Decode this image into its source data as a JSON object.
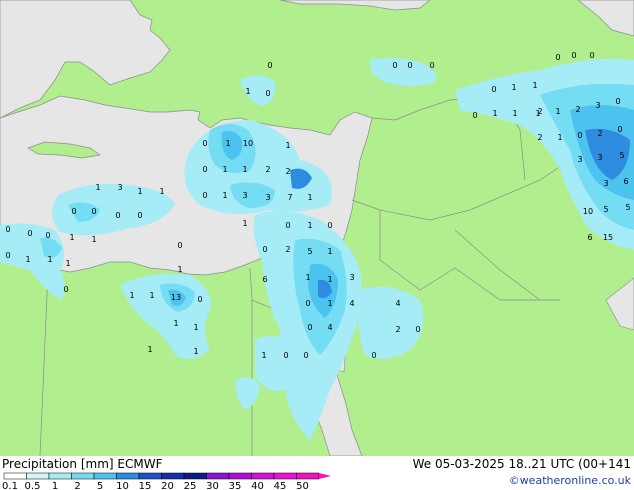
{
  "map": {
    "land_color": "#b0ee8e",
    "sea_color": "#e6e6e6",
    "border_color": "#8c8c8c",
    "labels": [
      "0",
      "1",
      "0",
      "0",
      "0",
      "0",
      "0",
      "0",
      "0",
      "1",
      "0",
      "1",
      "2",
      "2",
      "3",
      "0",
      "0",
      "1",
      "1",
      "1",
      "1",
      "2",
      "1",
      "0",
      "2",
      "0",
      "3",
      "3",
      "5",
      "3",
      "6",
      "10",
      "5",
      "5",
      "15",
      "6",
      "0",
      "1",
      "10",
      "1",
      "0",
      "1",
      "1",
      "2",
      "2",
      "0",
      "1",
      "3",
      "3",
      "7",
      "1",
      "1",
      "0",
      "1",
      "0",
      "1",
      "3",
      "1",
      "1",
      "0",
      "0",
      "0",
      "0",
      "0",
      "0",
      "0",
      "1",
      "1",
      "0",
      "0",
      "1",
      "1",
      "1",
      "0",
      "2",
      "5",
      "1",
      "1",
      "1",
      "3",
      "6",
      "0",
      "1",
      "4",
      "4",
      "0",
      "1",
      "1",
      "13",
      "0",
      "1",
      "1",
      "0",
      "4",
      "2",
      "0",
      "0",
      "1",
      "0",
      "0",
      "1",
      "1",
      "1"
    ]
  },
  "legend": {
    "title": "Precipitation [mm]",
    "model": "ECMWF",
    "ticks": [
      "0.1",
      "0.5",
      "1",
      "2",
      "5",
      "10",
      "15",
      "20",
      "25",
      "30",
      "35",
      "40",
      "45",
      "50"
    ],
    "colors": [
      "#ffffff",
      "#d4f4fb",
      "#a6ecf6",
      "#74dcf3",
      "#4cc2ee",
      "#2d8ce0",
      "#1e50c8",
      "#142fa8",
      "#0f1b84",
      "#8a14d2",
      "#b011d8",
      "#d411d6",
      "#ea11d2",
      "#f011c0"
    ]
  },
  "footer": {
    "datetime": "We 05-03-2025 18..21 UTC (00+141",
    "credit": "©weatheronline.co.uk"
  }
}
